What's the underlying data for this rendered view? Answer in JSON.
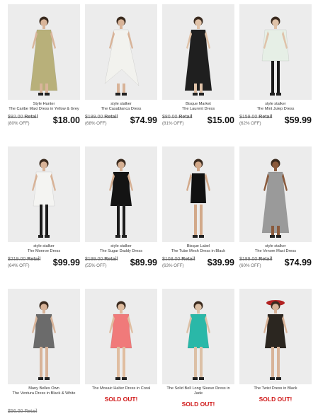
{
  "products": [
    {
      "brand": "Style Hunter",
      "name": "The Caribe Maxi Dress in Yellow & Grey",
      "retail": "$92.00",
      "off": "(80% OFF)",
      "price": "$18.00",
      "dress": "#b8b07a",
      "skin": "#d9b59a",
      "style": "maxi"
    },
    {
      "brand": "style stalker",
      "name": "The Casablanca Dress",
      "retail": "$189.00",
      "off": "(68% OFF)",
      "price": "$74.99",
      "dress": "#f2f2ee",
      "skin": "#d8b398",
      "style": "hilo"
    },
    {
      "brand": "Bisque Market",
      "name": "The Laurent Dress",
      "retail": "$80.00",
      "off": "(81% OFF)",
      "price": "$15.00",
      "dress": "#1f1f1f",
      "skin": "#e0c2a8",
      "style": "maxi"
    },
    {
      "brand": "style stalker",
      "name": "The Mint Julep Dress",
      "retail": "$159.00",
      "off": "(62% OFF)",
      "price": "$59.99",
      "dress": "#e6efe6",
      "skin": "#dfc2a9",
      "style": "tunic"
    },
    {
      "brand": "style stalker",
      "name": "The Monroe Dress",
      "retail": "$219.00",
      "off": "(64% OFF)",
      "price": "$99.99",
      "dress": "#f4f4f2",
      "skin": "#d8b398",
      "style": "short"
    },
    {
      "brand": "style stalker",
      "name": "The Sugar Daddy Dress",
      "retail": "$199.00",
      "off": "(55% OFF)",
      "price": "$89.99",
      "dress": "#141414",
      "skin": "#d6b093",
      "style": "short"
    },
    {
      "brand": "Bisque Label",
      "name": "The Tube Mesh Dress in Black",
      "retail": "$108.00",
      "off": "(63% OFF)",
      "price": "$39.99",
      "dress": "#111111",
      "skin": "#d2a98a",
      "style": "tube"
    },
    {
      "brand": "style stalker",
      "name": "The Venom Maxi Dress",
      "retail": "$189.00",
      "off": "(60% OFF)",
      "price": "$74.99",
      "dress": "#9a9a9a",
      "skin": "#8a5a3c",
      "style": "maxi"
    },
    {
      "brand": "Many Belles Own",
      "name": "The Ventura Dress in Black & White",
      "retail": "$56.00 Retail",
      "off": "",
      "price": "",
      "dress": "#6b6b6b",
      "skin": "#d8b398",
      "style": "short",
      "partial": true
    },
    {
      "brand": "",
      "name": "The Mosaic Halter Dress in Coral",
      "retail": "",
      "off": "",
      "price": "SOLD OUT!",
      "dress": "#f07a7a",
      "skin": "#e0bda0",
      "style": "short",
      "sold": true
    },
    {
      "brand": "",
      "name": "The Solid Bell Long Sleeve Dress in Jade",
      "retail": "",
      "off": "",
      "price": "SOLD OUT!",
      "dress": "#2ab8a8",
      "skin": "#dcc0a6",
      "style": "short",
      "sold": true
    },
    {
      "brand": "",
      "name": "The Twist Dress in Black",
      "retail": "",
      "off": "",
      "price": "SOLD OUT!",
      "dress": "#2b2620",
      "skin": "#d8b398",
      "style": "short",
      "sold": true,
      "hat": true
    }
  ],
  "labels": {
    "retail": "Retail"
  },
  "colors": {
    "sold_out": "#d01818",
    "price": "#111111",
    "placeholder_bg": "#e9e9e9"
  }
}
